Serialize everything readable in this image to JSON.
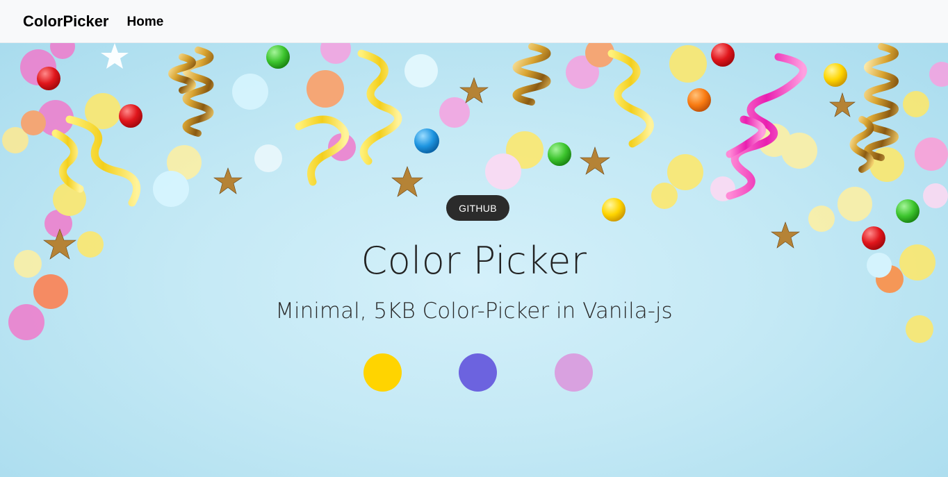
{
  "navbar": {
    "brand": "ColorPicker",
    "links": [
      {
        "label": "Home"
      }
    ]
  },
  "hero": {
    "github_label": "GITHUB",
    "title": "Color Picker",
    "subtitle": "Minimal, 5KB Color-Picker in Vanila-js"
  },
  "swatches": [
    {
      "color": "#ffd400"
    },
    {
      "color": "#6c63df"
    },
    {
      "color": "#d9a1e0"
    }
  ],
  "background": {
    "base_color": "#bfe6f3",
    "decor": [
      "confetti",
      "streamers",
      "star-sprinkles",
      "candy-balls"
    ]
  }
}
